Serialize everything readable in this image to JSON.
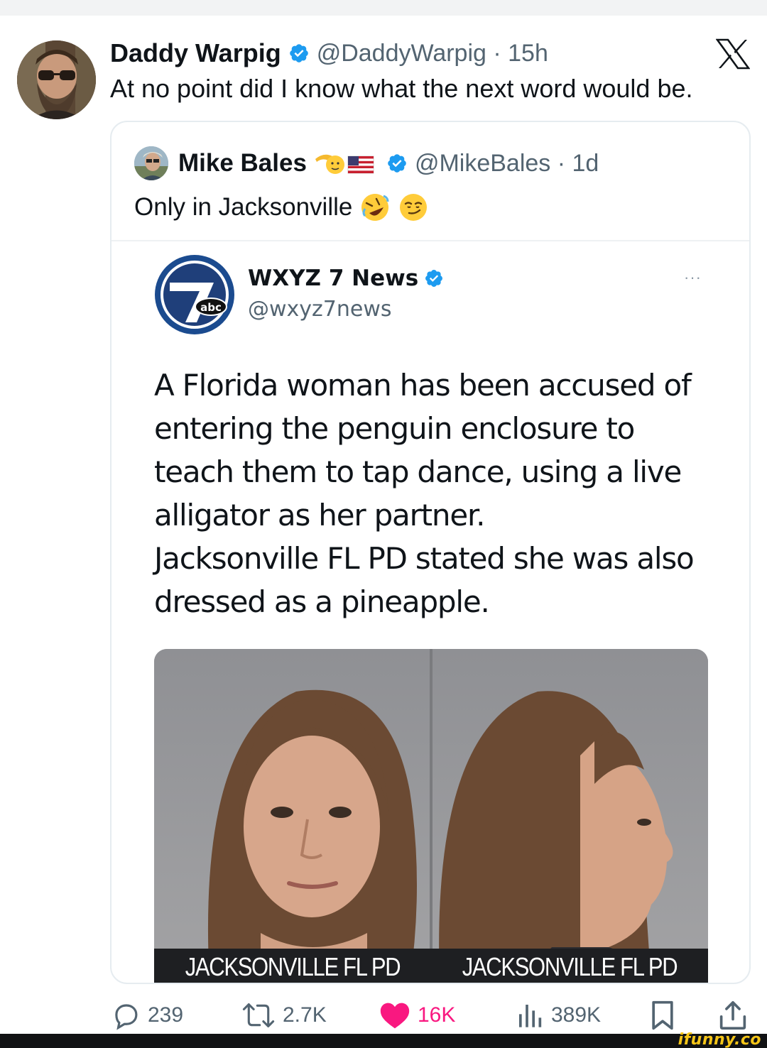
{
  "main_tweet": {
    "author_name": "Daddy Warpig",
    "handle_time": "@DaddyWarpig · 15h",
    "text": "At no point did I know what the next word would be.",
    "platform_icon": "x-logo-icon"
  },
  "quoted_tweet": {
    "author_name": "Mike Bales",
    "handle_time": "@MikeBales · 1d",
    "text": "Only in Jacksonville",
    "emojis": [
      "rolling-on-floor-laughing",
      "smirking-face"
    ]
  },
  "news_post": {
    "name": "WXYZ 7 News",
    "handle": "@wxyz7news",
    "logo_label": "abc",
    "logo_number": "7",
    "more": "···",
    "body_lines": [
      "A Florida woman has been accused of",
      "entering the penguin enclosure to",
      "teach them to tap dance, using a live",
      "alligator as her partner.",
      "Jacksonville FL PD stated she was also",
      "dressed as a pineapple."
    ],
    "photo_captions": [
      "JACKSONVILLE FL PD",
      "JACKSONVILLE FL PD"
    ]
  },
  "actions": {
    "replies": "239",
    "reposts": "2.7K",
    "likes": "16K",
    "views": "389K"
  },
  "watermark": "ifunny.co",
  "colors": {
    "verified_blue": "#1d9bf0",
    "like_pink": "#f91880",
    "text_secondary": "#536471"
  }
}
